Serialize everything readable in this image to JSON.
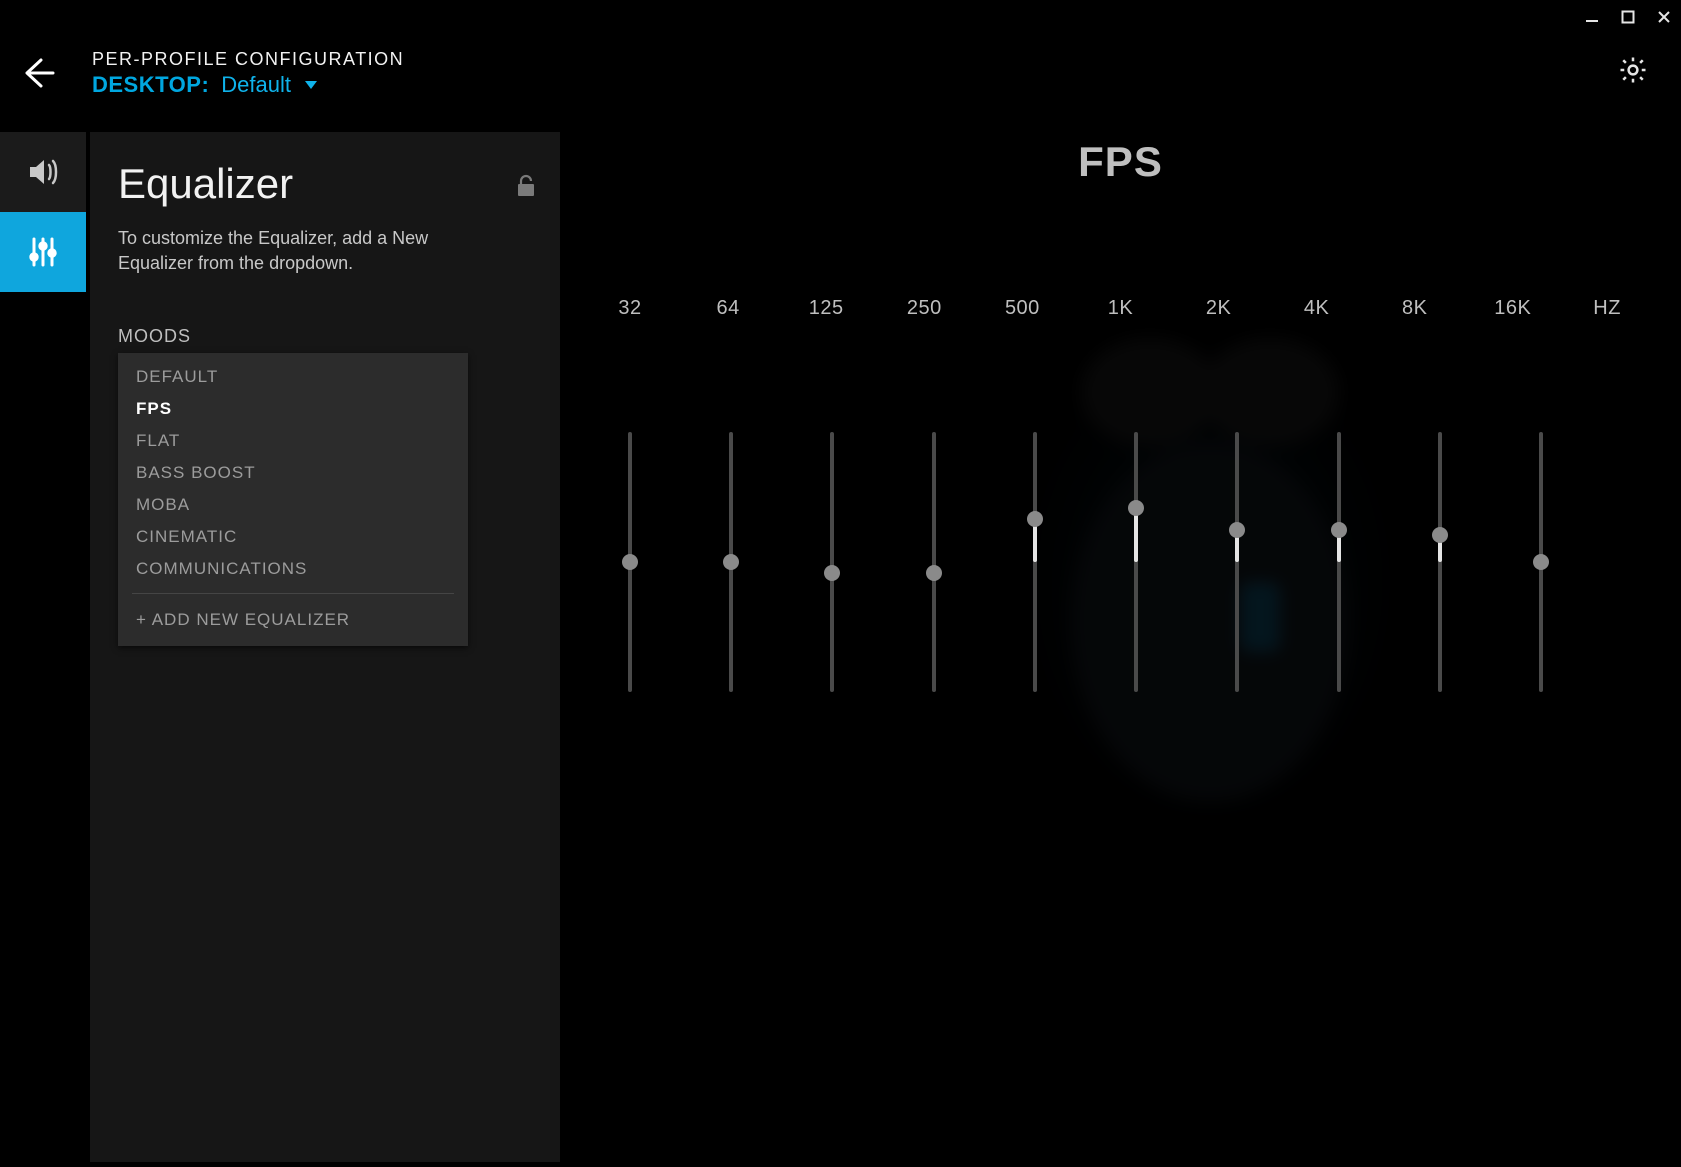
{
  "header": {
    "line1": "PER-PROFILE CONFIGURATION",
    "profile_label": "DESKTOP:",
    "profile_name": "Default"
  },
  "sidebar": {
    "title": "Equalizer",
    "description": "To customize the Equalizer, add a New Equalizer from the dropdown.",
    "moods_label": "MOODS",
    "moods": [
      {
        "label": "DEFAULT",
        "selected": false
      },
      {
        "label": "FPS",
        "selected": true
      },
      {
        "label": "FLAT",
        "selected": false
      },
      {
        "label": "BASS BOOST",
        "selected": false
      },
      {
        "label": "MOBA",
        "selected": false
      },
      {
        "label": "CINEMATIC",
        "selected": false
      },
      {
        "label": "COMMUNICATIONS",
        "selected": false
      }
    ],
    "add_new": "+ ADD NEW EQUALIZER"
  },
  "main": {
    "preset_name": "FPS",
    "unit": "HZ",
    "bands": [
      {
        "freq": "32",
        "value": 0
      },
      {
        "freq": "64",
        "value": 0
      },
      {
        "freq": "125",
        "value": -1
      },
      {
        "freq": "250",
        "value": -1
      },
      {
        "freq": "500",
        "value": 4
      },
      {
        "freq": "1K",
        "value": 5
      },
      {
        "freq": "2K",
        "value": 3
      },
      {
        "freq": "4K",
        "value": 3
      },
      {
        "freq": "8K",
        "value": 2.5
      },
      {
        "freq": "16K",
        "value": 0
      }
    ]
  },
  "colors": {
    "accent": "#0fa6dd"
  }
}
